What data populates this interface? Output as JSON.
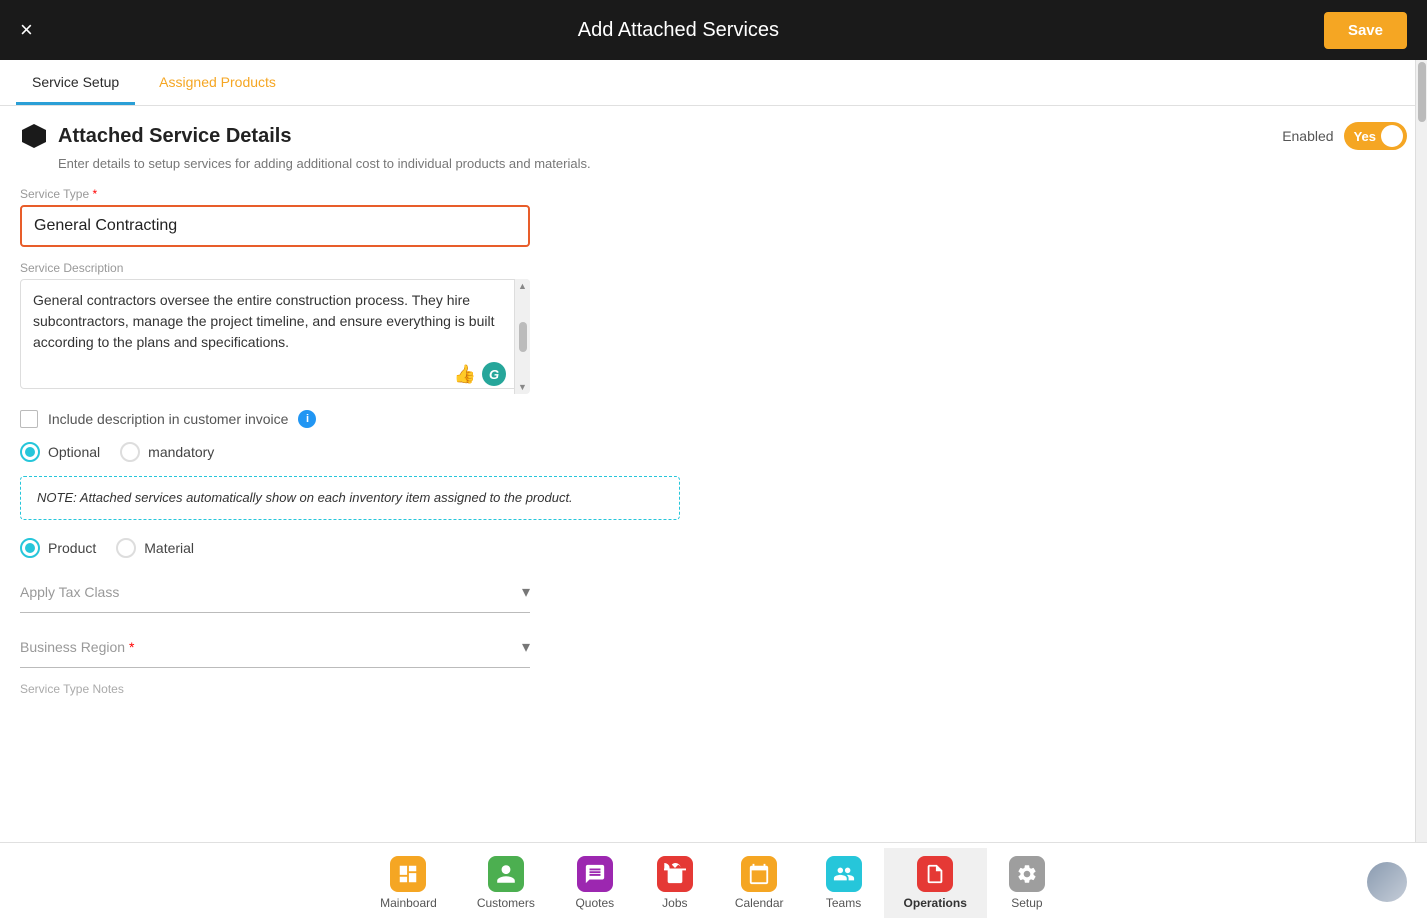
{
  "header": {
    "title": "Add Attached Services",
    "close_label": "×",
    "save_label": "Save"
  },
  "tabs": [
    {
      "id": "service-setup",
      "label": "Service Setup",
      "active": true
    },
    {
      "id": "assigned-products",
      "label": "Assigned Products",
      "active": false
    }
  ],
  "section": {
    "title": "Attached Service Details",
    "description": "Enter details to setup services for adding additional cost to individual products and materials.",
    "enabled_label": "Enabled",
    "toggle_label": "Yes"
  },
  "form": {
    "service_type_label": "Service Type",
    "service_type_value": "General Contracting",
    "service_description_label": "Service Description",
    "service_description_value": "General contractors oversee the entire construction process. They hire subcontractors, manage the project timeline, and ensure everything is built according to the plans and specifications.",
    "include_description_label": "Include description in customer invoice",
    "optional_label": "Optional",
    "mandatory_label": "mandatory",
    "note_text": "NOTE: Attached services automatically show on each inventory item assigned to the product.",
    "product_label": "Product",
    "material_label": "Material",
    "apply_tax_class_label": "Apply Tax Class",
    "business_region_label": "Business Region",
    "business_region_required": true,
    "service_type_notes_label": "Service Type Notes"
  },
  "bottom_nav": {
    "items": [
      {
        "id": "mainboard",
        "label": "Mainboard",
        "icon": "🏠",
        "bg": "#f5a623",
        "active": false
      },
      {
        "id": "customers",
        "label": "Customers",
        "icon": "👤",
        "bg": "#4caf50",
        "active": false
      },
      {
        "id": "quotes",
        "label": "Quotes",
        "icon": "💬",
        "bg": "#9c27b0",
        "active": false
      },
      {
        "id": "jobs",
        "label": "Jobs",
        "icon": "🔧",
        "bg": "#e53935",
        "active": false
      },
      {
        "id": "calendar",
        "label": "Calendar",
        "icon": "📅",
        "bg": "#f5a623",
        "active": false
      },
      {
        "id": "teams",
        "label": "Teams",
        "icon": "👥",
        "bg": "#26c6da",
        "active": false
      },
      {
        "id": "operations",
        "label": "Operations",
        "icon": "📋",
        "bg": "#e53935",
        "active": true
      },
      {
        "id": "setup",
        "label": "Setup",
        "icon": "⚙️",
        "bg": "#9e9e9e",
        "active": false
      }
    ]
  }
}
